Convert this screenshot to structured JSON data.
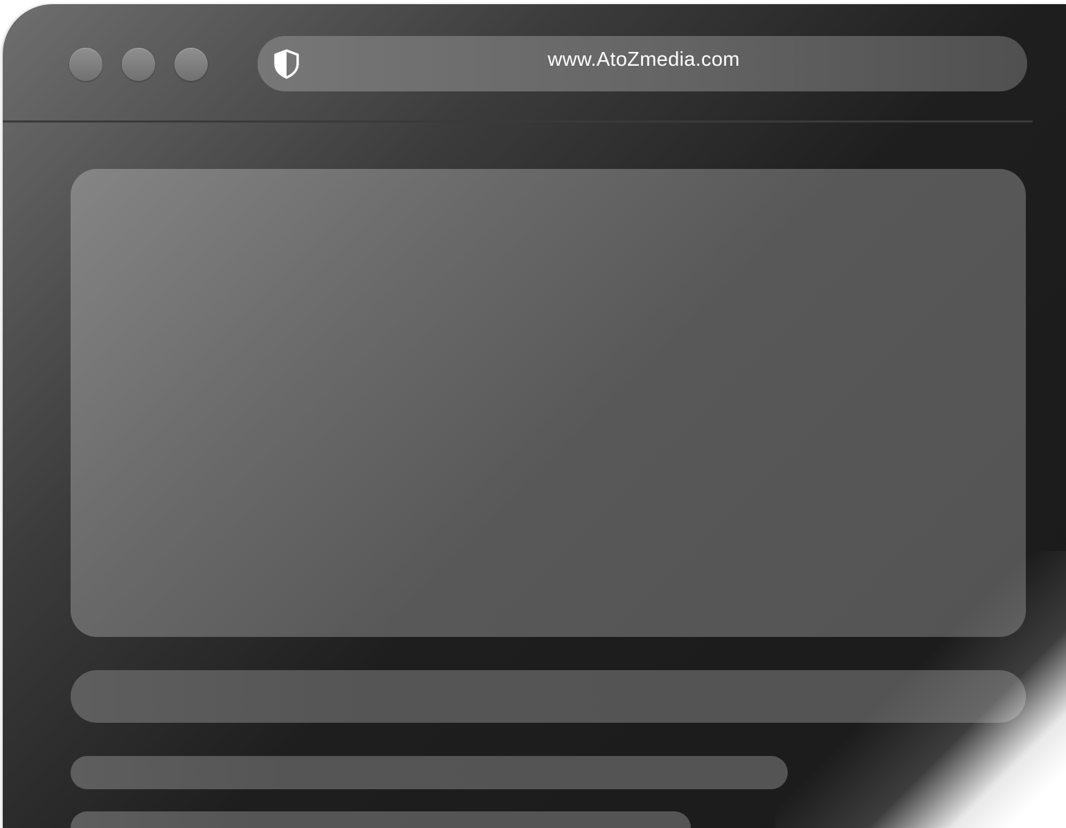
{
  "window": {
    "traffic_lights": [
      "close",
      "minimize",
      "maximize"
    ]
  },
  "address_bar": {
    "url": "www.AtoZmedia.com",
    "icon": "shield-icon"
  },
  "colors": {
    "window_dark": "#1a1a1a",
    "placeholder": "#555555",
    "text": "#ffffff"
  }
}
